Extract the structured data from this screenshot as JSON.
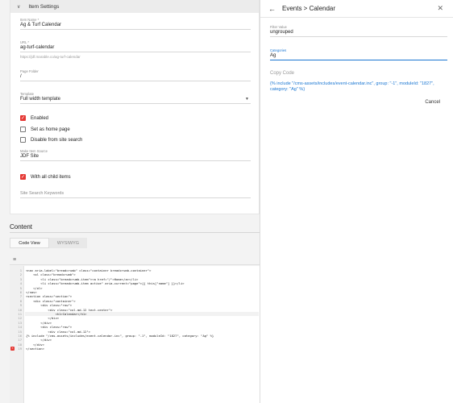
{
  "settings": {
    "header": "Item Settings",
    "item_name_label": "Item Name *",
    "item_name": "Ag & Turf Calendar",
    "url_label": "URL *",
    "url": "ag-turf-calendar",
    "url_hint": "https://jdf.marable.co/ag-turf-calendar",
    "page_folder_label": "Page Folder",
    "page_folder": "/",
    "template_label": "Template",
    "template": "Full width template",
    "enabled_label": "Enabled",
    "home_label": "Set as home page",
    "disable_search_label": "Disable from site search",
    "make_source_label": "Make Item Source",
    "make_source": "JDF Site",
    "child_items_label": "With all child items",
    "keywords_placeholder": "Site Search Keywords"
  },
  "content": {
    "title": "Content",
    "tab_code": "Code View",
    "tab_wysiwyg": "WYSIWYG"
  },
  "editor": {
    "line_numbers": [
      "1",
      "2",
      "3",
      "4",
      "5",
      "6",
      "7",
      "8",
      "9",
      "10",
      "11",
      "12",
      "13",
      "14",
      "15",
      "16",
      "17",
      "18",
      "19"
    ],
    "error_line": "19",
    "lines": [
      "<nav aria-label=\"breadcrumb\" class=\"container breadcrumb-container\">",
      "    <ol class=\"breadcrumb\">",
      "        <li class=\"breadcrumb-item\"><a href=\"/\">Home</a></li>",
      "        <li class=\"breadcrumb-item active\" aria-current=\"page\">{{ this[\"name\"] }}</li>",
      "    </ol>",
      "</nav>",
      "<section class=\"section\">",
      "    <div class=\"container\">",
      "        <div class=\"row\">",
      "            <div class=\"col-md-12 text-center\">",
      "                <h1>Calendar</h1>",
      "            </div>",
      "        </div>",
      "        <div class=\"row\">",
      "            <div class=\"col-md-12\">",
      "{% include \"/cms-assets/includes/event-calendar.inc\", group: \"-1\", moduleId: \"1827\", category: \"Ag\" %}",
      "        </div>",
      "    </div>",
      "</section>"
    ]
  },
  "panel": {
    "title": "Events > Calendar",
    "filter_label": "Filter Value",
    "filter_value": "ungrouped",
    "categories_label": "Categories",
    "categories_value": "Ag",
    "copy_code": "Copy Code",
    "snippet": "{% include \"/cms-assets/includes/event-calendar.inc\", group: \"-1\", moduleId: \"1827\", category: \"Ag\" %}",
    "cancel": "Cancel"
  },
  "colors": {
    "accent": "#1976d2",
    "checkbox": "#e53935"
  },
  "icons": [
    "chevron-down-icon",
    "select-arrow-icon",
    "checkbox-icon",
    "lines-icon",
    "back-arrow-icon",
    "close-icon",
    "error-icon"
  ]
}
